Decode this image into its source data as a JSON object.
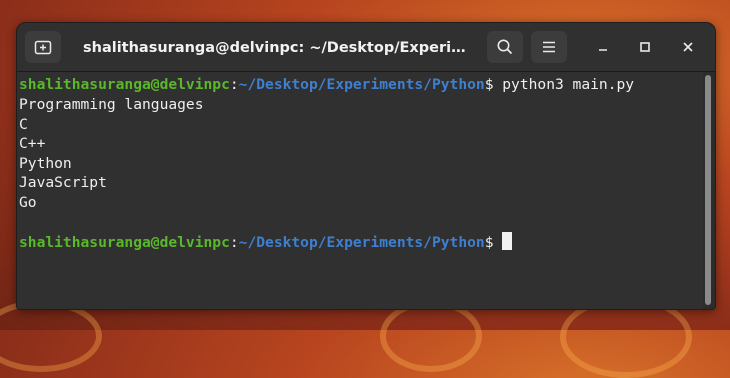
{
  "window": {
    "title": "shalithasuranga@delvinpc: ~/Desktop/Experime…"
  },
  "titlebar": {
    "new_tab_icon": "new-tab-icon",
    "search_icon": "search-icon",
    "menu_icon": "hamburger-menu-icon",
    "minimize_icon": "minimize-icon",
    "maximize_icon": "maximize-icon",
    "close_icon": "close-icon"
  },
  "terminal": {
    "prompt1": {
      "user": "shalithasuranga@delvinpc",
      "colon": ":",
      "path": "~/Desktop/Experiments/Python",
      "symbol": "$",
      "command": " python3 main.py"
    },
    "output": [
      "Programming languages",
      "C",
      "C++",
      "Python",
      "JavaScript",
      "Go"
    ],
    "prompt2": {
      "user": "shalithasuranga@delvinpc",
      "colon": ":",
      "path": "~/Desktop/Experiments/Python",
      "symbol": "$",
      "command": " "
    }
  },
  "colors": {
    "user": "#5ab82a",
    "path": "#3f7fd0",
    "text": "#efefef",
    "background": "#2c2c2c"
  }
}
